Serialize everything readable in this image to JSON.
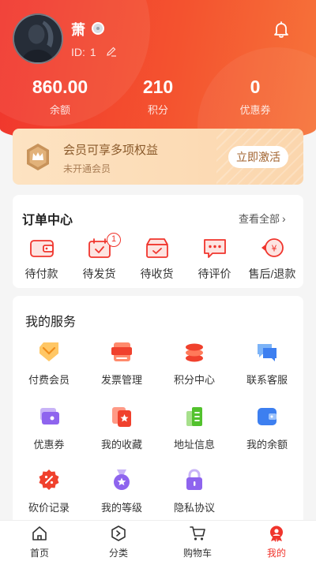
{
  "profile": {
    "name": "萧",
    "id_label": "ID:",
    "id_value": "1"
  },
  "stats": [
    {
      "value": "860.00",
      "label": "余额"
    },
    {
      "value": "210",
      "label": "积分"
    },
    {
      "value": "0",
      "label": "优惠券"
    }
  ],
  "vip": {
    "title": "会员可享多项权益",
    "subtitle": "未开通会员",
    "button": "立即激活"
  },
  "orders": {
    "title": "订单中心",
    "more": "查看全部",
    "items": [
      {
        "label": "待付款",
        "icon": "wallet-icon"
      },
      {
        "label": "待发货",
        "icon": "calendar-check-icon",
        "badge": "1"
      },
      {
        "label": "待收货",
        "icon": "box-icon"
      },
      {
        "label": "待评价",
        "icon": "comment-icon"
      },
      {
        "label": "售后/退款",
        "icon": "refund-icon"
      }
    ]
  },
  "services": {
    "title": "我的服务",
    "items": [
      {
        "label": "付费会员",
        "icon": "diamond-tag-icon"
      },
      {
        "label": "发票管理",
        "icon": "invoice-icon"
      },
      {
        "label": "积分中心",
        "icon": "coin-stack-icon"
      },
      {
        "label": "联系客服",
        "icon": "chat-icon"
      },
      {
        "label": "优惠券",
        "icon": "ticket-icon"
      },
      {
        "label": "我的收藏",
        "icon": "star-card-icon"
      },
      {
        "label": "地址信息",
        "icon": "address-icon"
      },
      {
        "label": "我的余额",
        "icon": "wallet-icon"
      },
      {
        "label": "砍价记录",
        "icon": "discount-icon"
      },
      {
        "label": "我的等级",
        "icon": "medal-icon"
      },
      {
        "label": "隐私协议",
        "icon": "lock-icon"
      }
    ]
  },
  "tabbar": {
    "items": [
      {
        "label": "首页",
        "icon": "home-icon"
      },
      {
        "label": "分类",
        "icon": "category-icon"
      },
      {
        "label": "购物车",
        "icon": "cart-icon"
      },
      {
        "label": "我的",
        "icon": "profile-icon",
        "active": true
      }
    ]
  },
  "colors": {
    "brand": "#f0352d",
    "header_gradient_end": "#f6743a",
    "vip_background": "#fde3c2",
    "vip_text": "#8a5a2b"
  }
}
